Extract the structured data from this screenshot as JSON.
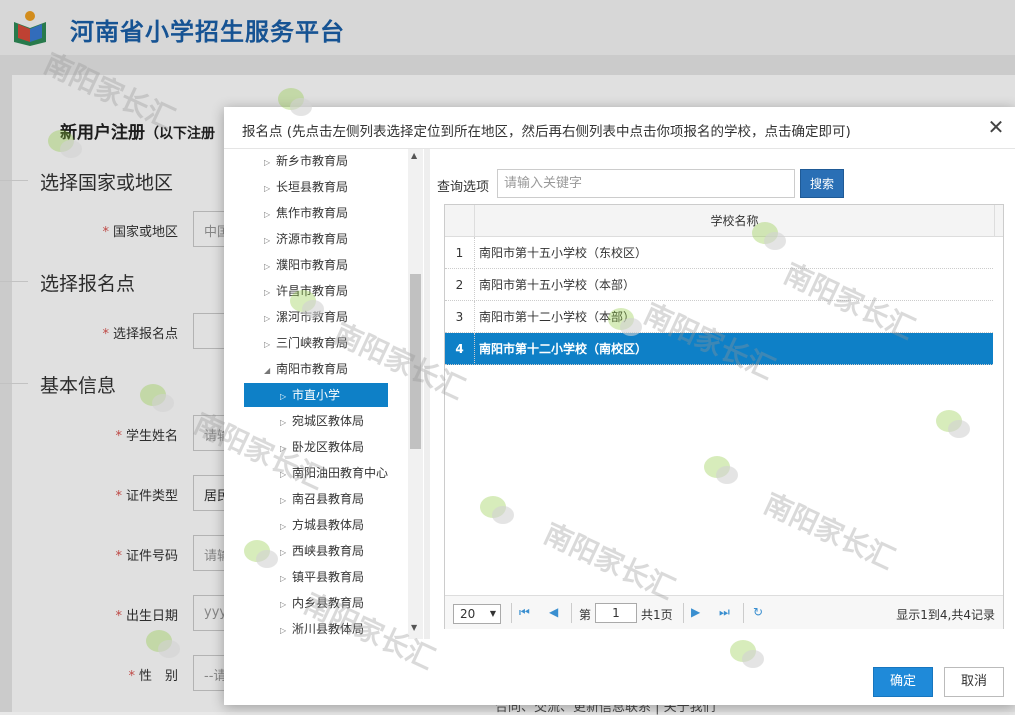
{
  "header": {
    "site_title": "河南省小学招生服务平台"
  },
  "background": {
    "reg_title": "新用户注册",
    "reg_title_note": "（以下注册",
    "sections": [
      "选择国家或地区",
      "选择报名点",
      "基本信息"
    ],
    "fields": [
      {
        "label": "国家或地区",
        "value": "中国"
      },
      {
        "label": "选择报名点",
        "value": ""
      },
      {
        "label": "学生姓名",
        "value": "请输入"
      },
      {
        "label": "证件类型",
        "value": "居民"
      },
      {
        "label": "证件号码",
        "value": "请输入"
      },
      {
        "label": "出生日期",
        "value": "yyyy"
      },
      {
        "label": "性　别",
        "value": "--请"
      }
    ],
    "footer": "合同、交流、更新信息联系 | 关于我们"
  },
  "modal": {
    "title": "报名点 (先点击左侧列表选择定位到所在地区，然后再右侧列表中点击你项报名的学校，点击确定即可)",
    "tree": [
      {
        "label": "新乡市教育局",
        "level": 0,
        "expanded": false,
        "selected": false
      },
      {
        "label": "长垣县教育局",
        "level": 0,
        "expanded": false,
        "selected": false
      },
      {
        "label": "焦作市教育局",
        "level": 0,
        "expanded": false,
        "selected": false
      },
      {
        "label": "济源市教育局",
        "level": 0,
        "expanded": false,
        "selected": false
      },
      {
        "label": "濮阳市教育局",
        "level": 0,
        "expanded": false,
        "selected": false
      },
      {
        "label": "许昌市教育局",
        "level": 0,
        "expanded": false,
        "selected": false
      },
      {
        "label": "漯河市教育局",
        "level": 0,
        "expanded": false,
        "selected": false
      },
      {
        "label": "三门峡教育局",
        "level": 0,
        "expanded": false,
        "selected": false
      },
      {
        "label": "南阳市教育局",
        "level": 0,
        "expanded": true,
        "selected": false
      },
      {
        "label": "市直小学",
        "level": 1,
        "expanded": false,
        "selected": true
      },
      {
        "label": "宛城区教体局",
        "level": 1,
        "expanded": false,
        "selected": false
      },
      {
        "label": "卧龙区教体局",
        "level": 1,
        "expanded": false,
        "selected": false
      },
      {
        "label": "南阳油田教育中心",
        "level": 1,
        "expanded": false,
        "selected": false
      },
      {
        "label": "南召县教育局",
        "level": 1,
        "expanded": false,
        "selected": false
      },
      {
        "label": "方城县教体局",
        "level": 1,
        "expanded": false,
        "selected": false
      },
      {
        "label": "西峡县教育局",
        "level": 1,
        "expanded": false,
        "selected": false
      },
      {
        "label": "镇平县教育局",
        "level": 1,
        "expanded": false,
        "selected": false
      },
      {
        "label": "内乡县教育局",
        "level": 1,
        "expanded": false,
        "selected": false
      },
      {
        "label": "淅川县教体局",
        "level": 1,
        "expanded": false,
        "selected": false
      }
    ],
    "search": {
      "label": "查询选项",
      "placeholder": "请输入关键字",
      "button": "搜索"
    },
    "grid": {
      "column": "学校名称",
      "rows": [
        {
          "num": "1",
          "name": "南阳市第十五小学校（东校区）",
          "selected": false
        },
        {
          "num": "2",
          "name": "南阳市第十五小学校（本部）",
          "selected": false
        },
        {
          "num": "3",
          "name": "南阳市第十二小学校（本部）",
          "selected": false
        },
        {
          "num": "4",
          "name": "南阳市第十二小学校（南校区）",
          "selected": true
        }
      ]
    },
    "pager": {
      "page_size": "20",
      "page_label_before": "第",
      "current_page": "1",
      "page_label_after": "共1页",
      "info": "显示1到4,共4记录"
    },
    "confirm": "确定",
    "cancel": "取消"
  },
  "watermark": "南阳家长汇"
}
